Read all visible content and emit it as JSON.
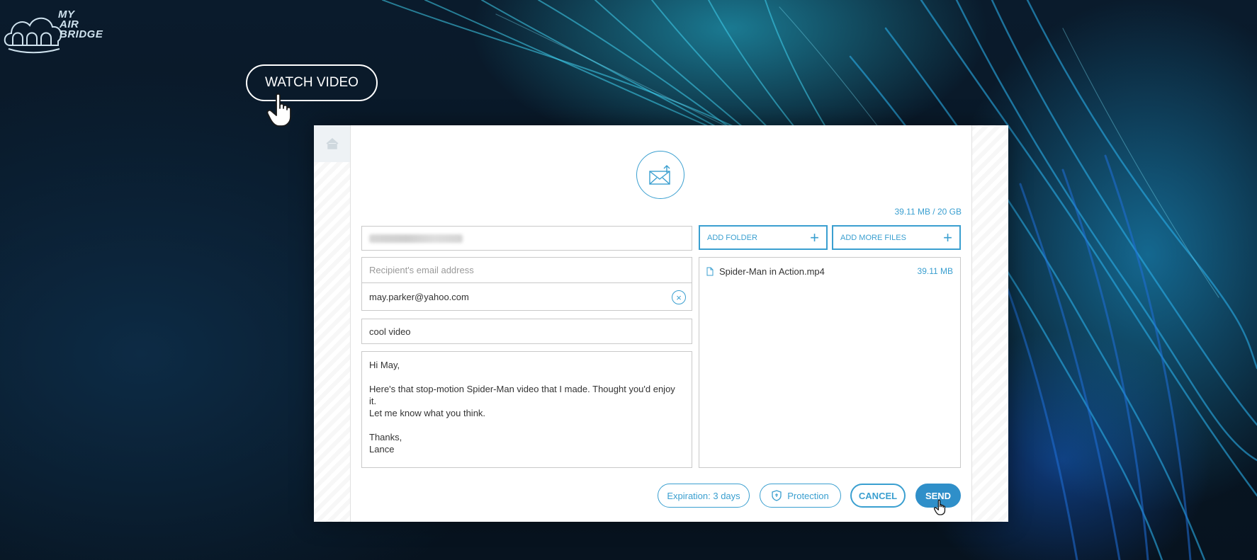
{
  "brand": {
    "logo_line1": "MY",
    "logo_line2": "AIR",
    "logo_line3": "BRIDGE",
    "accent_color": "#3a9fd0"
  },
  "watch_video": {
    "label": "WATCH VIDEO"
  },
  "upload": {
    "quota": "39.11 MB / 20 GB",
    "add_folder": "ADD FOLDER",
    "add_more_files": "ADD MORE FILES",
    "files": [
      {
        "name": "Spider-Man in Action.mp4",
        "size": "39.11 MB"
      }
    ]
  },
  "form": {
    "recipient_placeholder": "Recipient's email address",
    "recipients": [
      "may.parker@yahoo.com"
    ],
    "subject": "cool video",
    "message": {
      "line1": "Hi May,",
      "line2": "Here's that stop-motion Spider-Man video that I made. Thought you'd enjoy it.",
      "line3": "Let me know what you think.",
      "line4": "Thanks,",
      "line5": "Lance"
    }
  },
  "actions": {
    "expiration": "Expiration: 3 days",
    "protection": "Protection",
    "cancel": "CANCEL",
    "send": "SEND"
  },
  "icons": {
    "home": "home-icon",
    "envelope": "envelope-upload-icon",
    "plus": "plus-icon",
    "file": "file-icon",
    "remove": "close-circle-icon",
    "shield": "shield-icon",
    "cursor": "hand-pointer-icon"
  }
}
